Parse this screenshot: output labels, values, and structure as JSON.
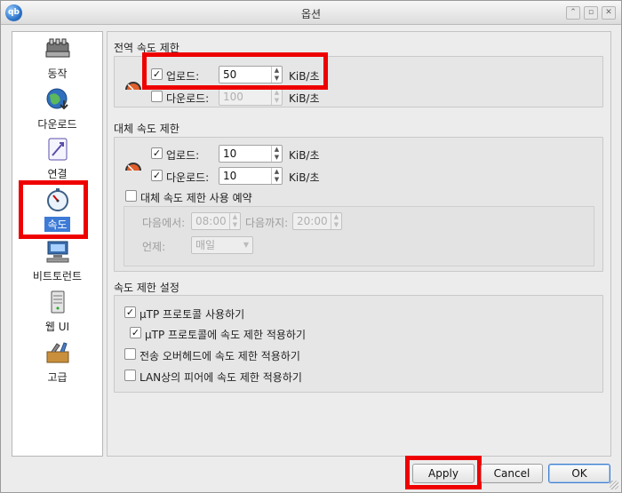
{
  "window": {
    "title": "옵션"
  },
  "sidebar": {
    "items": [
      {
        "label": "동작",
        "icon": "behavior-icon"
      },
      {
        "label": "다운로드",
        "icon": "downloads-globe-icon"
      },
      {
        "label": "연결",
        "icon": "connection-icon"
      },
      {
        "label": "속도",
        "icon": "speed-stopwatch-icon",
        "selected": true
      },
      {
        "label": "비트토런트",
        "icon": "bittorrent-icon"
      },
      {
        "label": "웹 UI",
        "icon": "webui-server-icon"
      },
      {
        "label": "고급",
        "icon": "advanced-tools-icon"
      }
    ]
  },
  "global": {
    "title": "전역 속도 제한",
    "upload": {
      "label": "업로드:",
      "checked": true,
      "value": "50",
      "unit": "KiB/초"
    },
    "download": {
      "label": "다운로드:",
      "checked": false,
      "value": "100",
      "unit": "KiB/초"
    }
  },
  "alt": {
    "title": "대체 속도 제한",
    "upload": {
      "label": "업로드:",
      "checked": true,
      "value": "10",
      "unit": "KiB/초"
    },
    "download": {
      "label": "다운로드:",
      "checked": true,
      "value": "10",
      "unit": "KiB/초"
    },
    "schedule": {
      "label": "대체 속도 제한 사용 예약",
      "from_label": "다음에서:",
      "from": "08:00",
      "to_label": "다음까지:",
      "to": "20:00",
      "when_label": "언제:",
      "when": "매일"
    }
  },
  "settings": {
    "title": "속도 제한 설정",
    "utp": "µTP 프로토콜 사용하기",
    "utp_limit": "µTP 프로토콜에 속도 제한 적용하기",
    "overhead": "전송 오버헤드에 속도 제한 적용하기",
    "lan": "LAN상의 피어에 속도 제한 적용하기"
  },
  "buttons": {
    "apply": "Apply",
    "cancel": "Cancel",
    "ok": "OK"
  },
  "check_mark": "✓"
}
